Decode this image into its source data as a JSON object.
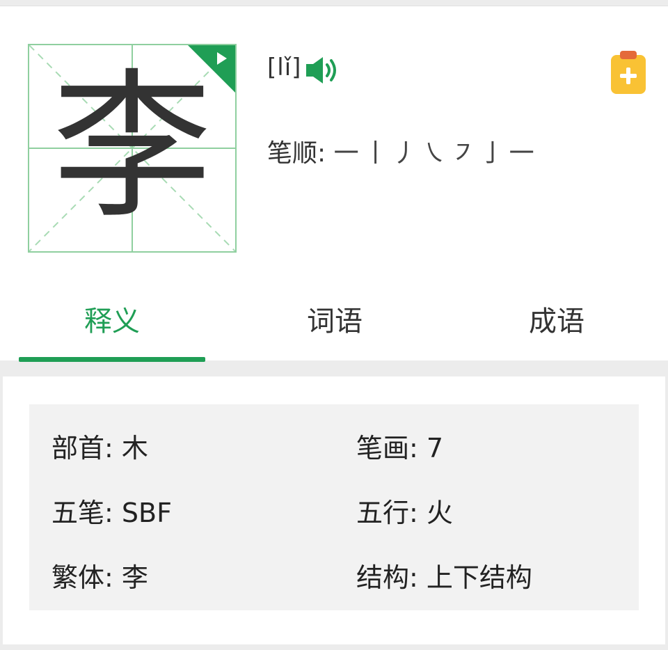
{
  "character": {
    "glyph": "李",
    "pinyin": "[lǐ]",
    "stroke_order_label": "笔顺:",
    "strokes": "一丨丿㇏㇇亅一"
  },
  "tabs": [
    {
      "label": "释义",
      "active": true
    },
    {
      "label": "词语",
      "active": false
    },
    {
      "label": "成语",
      "active": false
    }
  ],
  "info": {
    "radical": "部首: 木",
    "stroke_count": "笔画: 7",
    "wubi": "五笔: SBF",
    "wuxing": "五行: 火",
    "traditional": "繁体: 李",
    "structure": "结构: 上下结构"
  },
  "colors": {
    "accent": "#1f9e55",
    "grid": "#8fcf9f",
    "clipboard": "#f9c234"
  },
  "icons": {
    "play": "play-corner-icon",
    "speaker": "speaker-icon",
    "add": "clipboard-add-icon"
  }
}
